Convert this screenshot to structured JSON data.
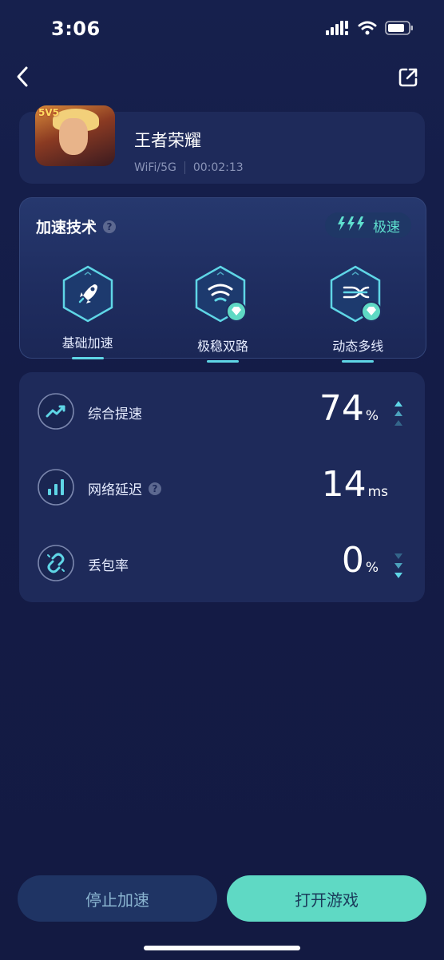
{
  "status_bar": {
    "time": "3:06",
    "icons": [
      "cellular-icon",
      "wifi-icon",
      "battery-icon"
    ]
  },
  "nav": {
    "back_icon": "chevron-left-icon",
    "share_icon": "share-icon"
  },
  "game": {
    "title": "王者荣耀",
    "network": "WiFi/5G",
    "duration": "00:02:13",
    "icon_badge": "5V5"
  },
  "tech": {
    "title": "加速技术",
    "help_icon": "question-icon",
    "badge_label": "极速",
    "badge_icon": "lightning-icon",
    "items": [
      {
        "label": "基础加速",
        "icon": "rocket-icon",
        "premium": false
      },
      {
        "label": "极稳双路",
        "icon": "wifi-signal-icon",
        "premium": true
      },
      {
        "label": "动态多线",
        "icon": "multiline-icon",
        "premium": true
      }
    ]
  },
  "stats": [
    {
      "label": "综合提速",
      "value": "74",
      "unit": "%",
      "icon": "trend-up-icon",
      "has_help": false,
      "arrow": "up"
    },
    {
      "label": "网络延迟",
      "value": "14",
      "unit": "ms",
      "icon": "bar-chart-icon",
      "has_help": true,
      "arrow": "none"
    },
    {
      "label": "丢包率",
      "value": "0",
      "unit": "%",
      "icon": "broken-link-icon",
      "has_help": false,
      "arrow": "down"
    }
  ],
  "buttons": {
    "stop": "停止加速",
    "open": "打开游戏"
  },
  "colors": {
    "background": "#141c45",
    "card": "#1e2a5a",
    "accent": "#5fd9c4",
    "accent_cyan": "#5fd6e6"
  }
}
